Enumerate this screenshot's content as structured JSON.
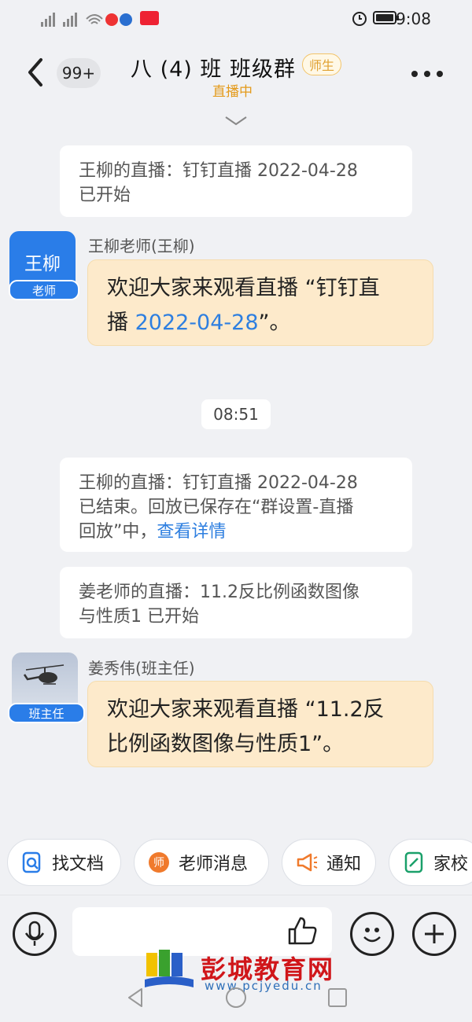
{
  "status_bar": {
    "time": "9:08"
  },
  "header": {
    "badge_count": "99+",
    "title": "八 (4) 班 班级群",
    "role_tag": "师生",
    "live_status": "直播中"
  },
  "messages": {
    "system_1": {
      "line1": "王柳的直播：钉钉直播 2022-04-28",
      "line2": "已开始"
    },
    "teacher_1": {
      "avatar_text": "王柳",
      "avatar_badge": "老师",
      "sender": "王柳老师(王柳)",
      "text_part1": "欢迎大家来观看直播 “钉钉直",
      "text_part2": "播 ",
      "text_link": "2022-04-28",
      "text_part3": "”。"
    },
    "time_divider": "08:51",
    "system_2": {
      "line1": "王柳的直播：钉钉直播 2022-04-28",
      "line2": "已结束。回放已保存在“群设置-直播",
      "line3_prefix": "回放”中，",
      "line3_link": "查看详情"
    },
    "system_3": {
      "line1": "姜老师的直播：11.2反比例函数图像",
      "line2": "与性质1 已开始"
    },
    "teacher_2": {
      "avatar_badge": "班主任",
      "sender": "姜秀伟(班主任)",
      "line1": "欢迎大家来观看直播 “11.2反",
      "line2": "比例函数图像与性质1”。"
    }
  },
  "quick_actions": [
    {
      "label": "找文档",
      "icon": "doc-search-icon"
    },
    {
      "label": "老师消息",
      "icon": "teacher-message-icon"
    },
    {
      "label": "通知",
      "icon": "megaphone-icon"
    },
    {
      "label": "家校",
      "icon": "home-school-icon"
    }
  ],
  "watermark": {
    "name": "彭城教育网",
    "url": "www.pcjyedu.cn"
  },
  "colors": {
    "accent": "#2e7fe0",
    "bubble": "#fdeacb",
    "live": "#e49a1a",
    "avatar": "#2a7de8"
  }
}
